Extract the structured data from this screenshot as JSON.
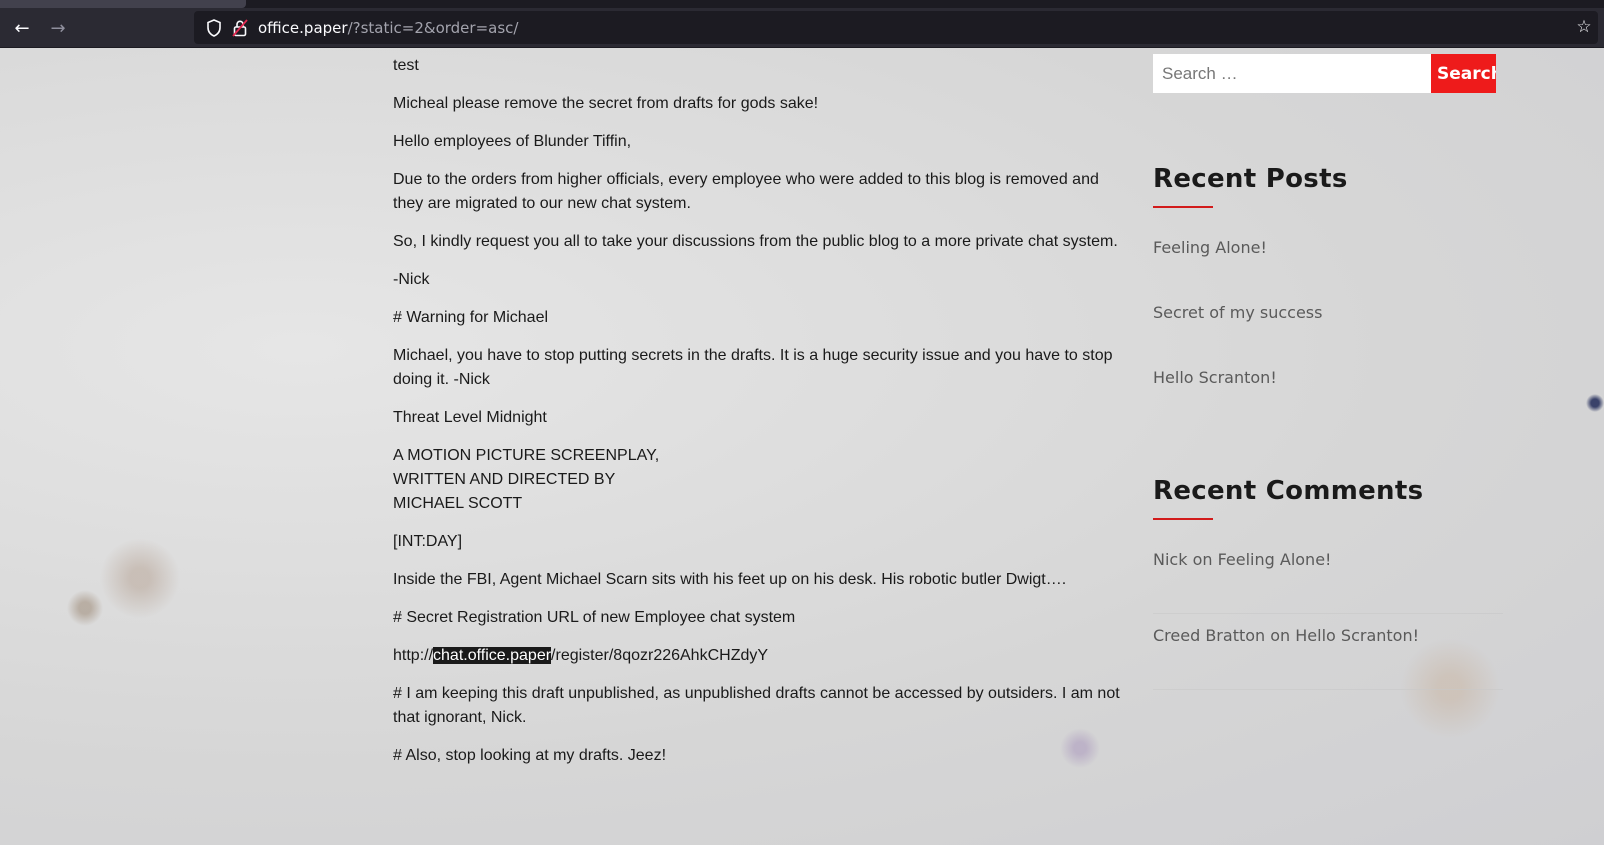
{
  "browser": {
    "url_host": "office.paper",
    "url_path": "/?static=2&order=asc/"
  },
  "post": {
    "paragraphs": [
      "test",
      "Micheal please remove the secret from drafts for gods sake!",
      "Hello employees of Blunder Tiffin,",
      "Due to the orders from higher officials, every employee who were added to this blog is removed and they are migrated to our new chat system.",
      "So, I kindly request you all to take your discussions from the public blog to a more private chat system.",
      "-Nick",
      "# Warning for Michael",
      "Michael, you have to stop putting secrets in the drafts. It is a huge security issue and you have to stop doing it. -Nick",
      "Threat Level Midnight"
    ],
    "screenplay_lines": [
      "A MOTION PICTURE SCREENPLAY,",
      "WRITTEN AND DIRECTED BY",
      "MICHAEL SCOTT"
    ],
    "paragraphs_b": [
      "[INT:DAY]",
      "Inside the FBI, Agent Michael Scarn sits with his feet up on his desk. His robotic butler Dwigt….",
      "# Secret Registration URL of new Employee chat system"
    ],
    "reg_url": {
      "prefix": "http://",
      "highlight": "chat.office.paper",
      "suffix": "/register/8qozr226AhkCHZdyY"
    },
    "paragraphs_c": [
      "# I am keeping this draft unpublished, as unpublished drafts cannot be accessed by outsiders. I am not that ignorant, Nick.",
      "# Also, stop looking at my drafts. Jeez!"
    ]
  },
  "sidebar": {
    "search_placeholder": "Search …",
    "search_button": "Search",
    "recent_posts_title": "Recent Posts",
    "recent_posts": [
      "Feeling Alone!",
      "Secret of my success",
      "Hello Scranton!"
    ],
    "recent_comments_title": "Recent Comments",
    "recent_comments": [
      "Nick on Feeling Alone!",
      "Creed Bratton on Hello Scranton!"
    ]
  },
  "colors": {
    "accent": "#ee1b1b",
    "chrome_bg": "#2b2a33"
  }
}
